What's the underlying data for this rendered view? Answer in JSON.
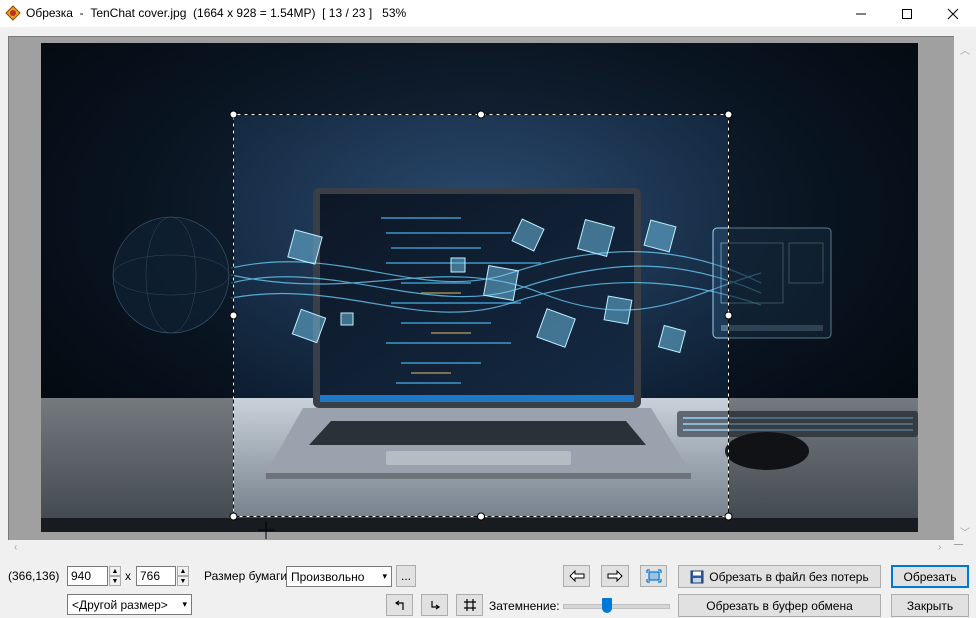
{
  "window": {
    "title": "Обрезка  -  TenChat cover.jpg  (1664 x 928 = 1.54MP)  [ 13 / 23 ]   53%",
    "minimize": "—",
    "maximize": "☐",
    "close": "✕"
  },
  "status": {
    "coords": "(366,136)"
  },
  "size": {
    "width": "940",
    "separator": "x",
    "height": "766",
    "preset": "<Другой размер>"
  },
  "paper": {
    "label": "Размер бумаги:",
    "value": "Произвольно",
    "more": "..."
  },
  "dim": {
    "label": "Затемнение:",
    "level": 0.42
  },
  "buttons": {
    "crop_lossless": "Обрезать в файл без потерь",
    "crop_clipboard": "Обрезать в буфер обмена",
    "crop": "Обрезать",
    "close": "Закрыть"
  },
  "icons": {
    "prev": "arrow-left-icon",
    "next": "arrow-right-icon",
    "fit": "fit-selection-icon",
    "rotate_left": "rotate-left-icon",
    "rotate_right": "rotate-right-icon",
    "grid": "grid-icon",
    "save": "floppy-icon"
  },
  "colors": {
    "accent": "#0078d7"
  }
}
